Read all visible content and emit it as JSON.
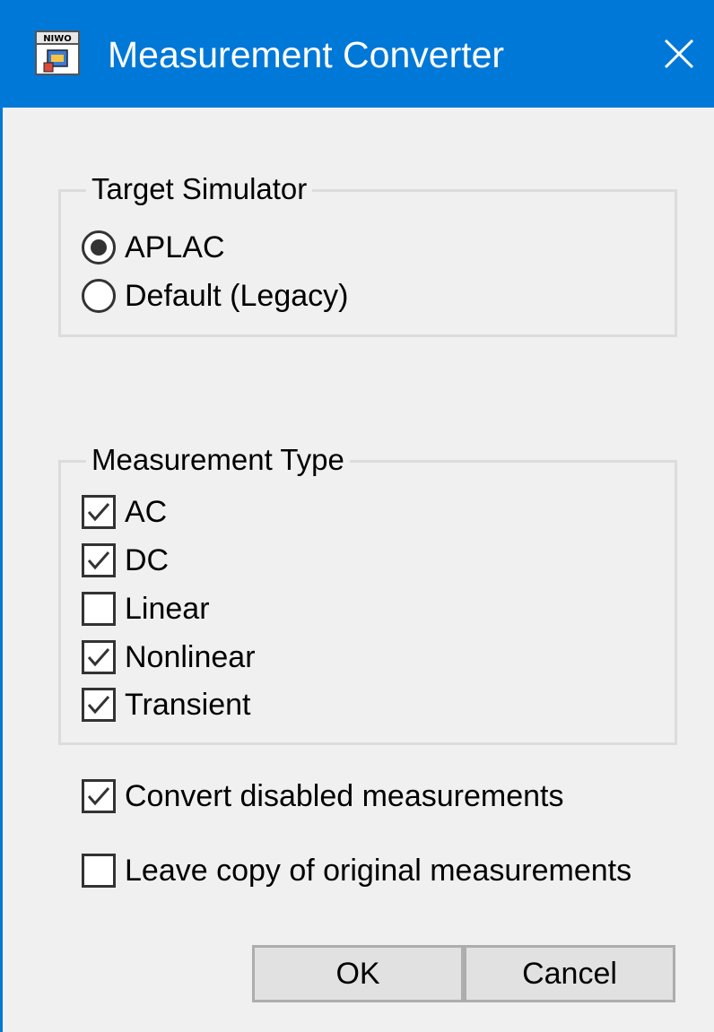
{
  "window": {
    "title": "Measurement Converter",
    "app_icon_text": "NIWO",
    "accent_color": "#0078d7"
  },
  "target_simulator": {
    "label": "Target Simulator",
    "options": [
      {
        "label": "APLAC",
        "selected": true
      },
      {
        "label": "Default (Legacy)",
        "selected": false
      }
    ]
  },
  "measurement_type": {
    "label": "Measurement Type",
    "options": [
      {
        "label": "AC",
        "checked": true
      },
      {
        "label": "DC",
        "checked": true
      },
      {
        "label": "Linear",
        "checked": false
      },
      {
        "label": "Nonlinear",
        "checked": true
      },
      {
        "label": "Transient",
        "checked": true
      }
    ]
  },
  "extra_options": [
    {
      "label": "Convert disabled measurements",
      "checked": true
    },
    {
      "label": "Leave copy of original measurements",
      "checked": false
    }
  ],
  "buttons": {
    "ok": "OK",
    "cancel": "Cancel"
  }
}
